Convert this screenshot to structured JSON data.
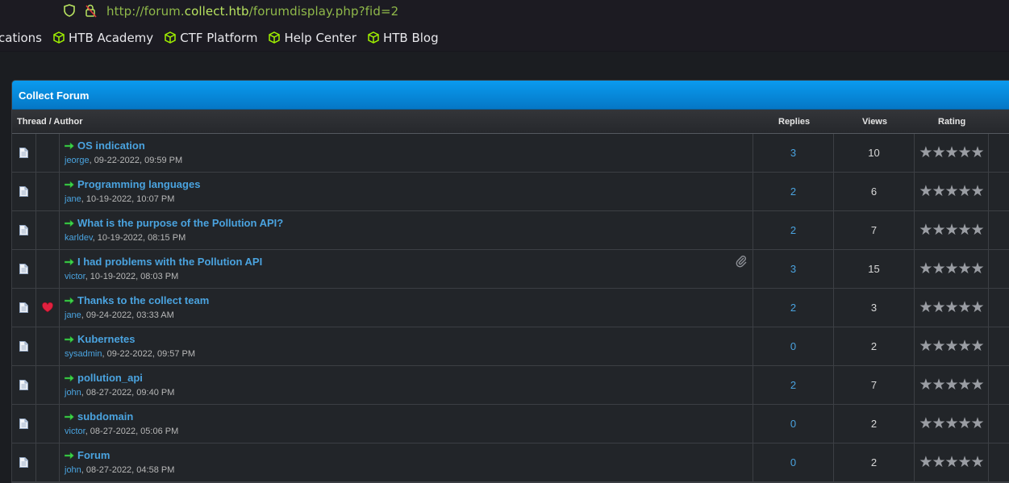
{
  "browser": {
    "url_prefix": "http://forum.",
    "url_host": "collect.htb",
    "url_path": "/forumdisplay.php?fid=2",
    "bookmarks": [
      {
        "label": "cations"
      },
      {
        "label": "HTB Academy"
      },
      {
        "label": "CTF Platform"
      },
      {
        "label": "Help Center"
      },
      {
        "label": "HTB Blog"
      }
    ]
  },
  "forum": {
    "title": "Collect Forum",
    "columns": {
      "thread_author": "Thread / Author",
      "replies": "Replies",
      "views": "Views",
      "rating": "Rating"
    },
    "stars": "★★★★★",
    "threads": [
      {
        "title": "OS indication",
        "author": "jeorge",
        "date": ", 09-22-2022, 09:59 PM",
        "replies": "3",
        "views": "10"
      },
      {
        "title": "Programming languages",
        "author": "jane",
        "date": ", 10-19-2022, 10:07 PM",
        "replies": "2",
        "views": "6"
      },
      {
        "title": "What is the purpose of the Pollution API?",
        "author": "karldev",
        "date": ", 10-19-2022, 08:15 PM",
        "replies": "2",
        "views": "7"
      },
      {
        "title": "I had problems with the Pollution API",
        "author": "victor",
        "date": ", 10-19-2022, 08:03 PM",
        "replies": "3",
        "views": "15"
      },
      {
        "title": "Thanks to the collect team",
        "author": "jane",
        "date": ", 09-24-2022, 03:33 AM",
        "replies": "2",
        "views": "3"
      },
      {
        "title": "Kubernetes",
        "author": "sysadmin",
        "date": ", 09-22-2022, 09:57 PM",
        "replies": "0",
        "views": "2"
      },
      {
        "title": "pollution_api",
        "author": "john",
        "date": ", 08-27-2022, 09:40 PM",
        "replies": "2",
        "views": "7"
      },
      {
        "title": "subdomain",
        "author": "victor",
        "date": ", 08-27-2022, 05:06 PM",
        "replies": "0",
        "views": "2"
      },
      {
        "title": "Forum",
        "author": "john",
        "date": ", 08-27-2022, 04:58 PM",
        "replies": "0",
        "views": "2"
      }
    ]
  },
  "colors": {
    "accent": "#0a9bef",
    "link": "#4aa3df",
    "url_green": "#b8e360"
  }
}
